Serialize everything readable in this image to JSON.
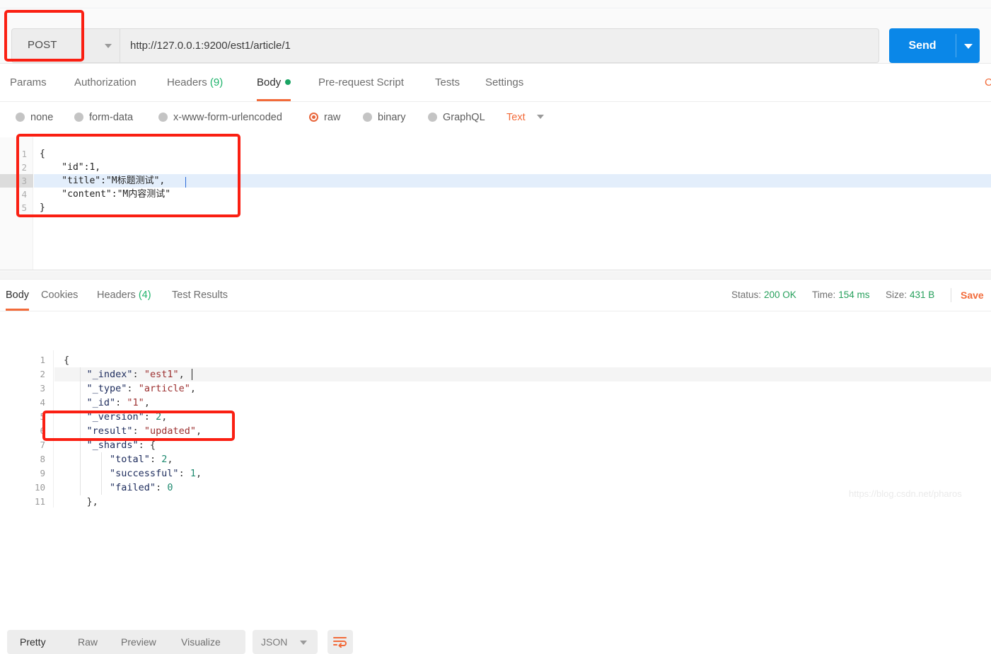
{
  "request": {
    "method": "POST",
    "url": "http://127.0.0.1:9200/est1/article/1",
    "send_label": "Send",
    "tabs": [
      {
        "label": "Params",
        "count": ""
      },
      {
        "label": "Authorization",
        "count": ""
      },
      {
        "label": "Headers",
        "count": "(9)"
      },
      {
        "label": "Body",
        "count": ""
      },
      {
        "label": "Pre-request Script",
        "count": ""
      },
      {
        "label": "Tests",
        "count": ""
      },
      {
        "label": "Settings",
        "count": ""
      }
    ],
    "cookies_cut_label": "C",
    "body_types": [
      {
        "label": "none"
      },
      {
        "label": "form-data"
      },
      {
        "label": "x-www-form-urlencoded"
      },
      {
        "label": "raw"
      },
      {
        "label": "binary"
      },
      {
        "label": "GraphQL"
      }
    ],
    "raw_format": "Text",
    "body_lines": [
      {
        "num": "1",
        "text": "{"
      },
      {
        "num": "2",
        "text": "    \"id\":1,"
      },
      {
        "num": "3",
        "text": "    \"title\":\"M标题测试\","
      },
      {
        "num": "4",
        "text": "    \"content\":\"M内容测试\""
      },
      {
        "num": "5",
        "text": "}"
      }
    ]
  },
  "response": {
    "tabs": [
      {
        "label": "Body",
        "count": ""
      },
      {
        "label": "Cookies",
        "count": ""
      },
      {
        "label": "Headers",
        "count": "(4)"
      },
      {
        "label": "Test Results",
        "count": ""
      }
    ],
    "status_label": "Status:",
    "status_value": "200 OK",
    "time_label": "Time:",
    "time_value": "154 ms",
    "size_label": "Size:",
    "size_value": "431 B",
    "save_label": "Save",
    "view_modes": [
      {
        "label": "Pretty"
      },
      {
        "label": "Raw"
      },
      {
        "label": "Preview"
      },
      {
        "label": "Visualize"
      }
    ],
    "format": "JSON",
    "body_lines": [
      {
        "num": "1",
        "parts": [
          {
            "t": "{",
            "c": "p"
          }
        ]
      },
      {
        "num": "2",
        "parts": [
          {
            "t": "    ",
            "c": "p"
          },
          {
            "t": "\"_index\"",
            "c": "k"
          },
          {
            "t": ": ",
            "c": "p"
          },
          {
            "t": "\"est1\"",
            "c": "s"
          },
          {
            "t": ",",
            "c": "p"
          }
        ]
      },
      {
        "num": "3",
        "parts": [
          {
            "t": "    ",
            "c": "p"
          },
          {
            "t": "\"_type\"",
            "c": "k"
          },
          {
            "t": ": ",
            "c": "p"
          },
          {
            "t": "\"article\"",
            "c": "s"
          },
          {
            "t": ",",
            "c": "p"
          }
        ]
      },
      {
        "num": "4",
        "parts": [
          {
            "t": "    ",
            "c": "p"
          },
          {
            "t": "\"_id\"",
            "c": "k"
          },
          {
            "t": ": ",
            "c": "p"
          },
          {
            "t": "\"1\"",
            "c": "s"
          },
          {
            "t": ",",
            "c": "p"
          }
        ]
      },
      {
        "num": "5",
        "parts": [
          {
            "t": "    ",
            "c": "p"
          },
          {
            "t": "\"_version\"",
            "c": "k"
          },
          {
            "t": ": ",
            "c": "p"
          },
          {
            "t": "2",
            "c": "n"
          },
          {
            "t": ",",
            "c": "p"
          }
        ]
      },
      {
        "num": "6",
        "parts": [
          {
            "t": "    ",
            "c": "p"
          },
          {
            "t": "\"result\"",
            "c": "k"
          },
          {
            "t": ": ",
            "c": "p"
          },
          {
            "t": "\"updated\"",
            "c": "s"
          },
          {
            "t": ",",
            "c": "p"
          }
        ]
      },
      {
        "num": "7",
        "parts": [
          {
            "t": "    ",
            "c": "p"
          },
          {
            "t": "\"_shards\"",
            "c": "k"
          },
          {
            "t": ": {",
            "c": "p"
          }
        ]
      },
      {
        "num": "8",
        "parts": [
          {
            "t": "        ",
            "c": "p"
          },
          {
            "t": "\"total\"",
            "c": "k"
          },
          {
            "t": ": ",
            "c": "p"
          },
          {
            "t": "2",
            "c": "n"
          },
          {
            "t": ",",
            "c": "p"
          }
        ]
      },
      {
        "num": "9",
        "parts": [
          {
            "t": "        ",
            "c": "p"
          },
          {
            "t": "\"successful\"",
            "c": "k"
          },
          {
            "t": ": ",
            "c": "p"
          },
          {
            "t": "1",
            "c": "n"
          },
          {
            "t": ",",
            "c": "p"
          }
        ]
      },
      {
        "num": "10",
        "parts": [
          {
            "t": "        ",
            "c": "p"
          },
          {
            "t": "\"failed\"",
            "c": "k"
          },
          {
            "t": ": ",
            "c": "p"
          },
          {
            "t": "0",
            "c": "n"
          }
        ]
      },
      {
        "num": "11",
        "parts": [
          {
            "t": "    },",
            "c": "p"
          }
        ]
      }
    ]
  },
  "watermark": "https://blog.csdn.net/pharos",
  "colors": {
    "accent_orange": "#f26b3a",
    "send_blue": "#0a87e8",
    "status_green": "#27a05c",
    "annotation_red": "#fa1f12"
  }
}
